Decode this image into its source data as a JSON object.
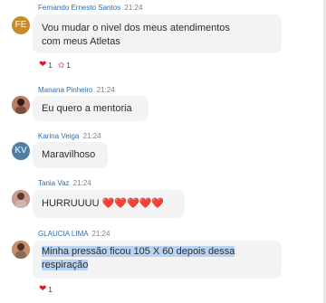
{
  "messages": [
    {
      "sender": "Fernando Ernesto Santos",
      "time": "21:24",
      "avatar_initials": "FE",
      "text": "Vou mudar o nivel dos meus atendimentos\ncom meus Atletas",
      "reactions": [
        {
          "icon": "heart-icon",
          "count": "1"
        },
        {
          "icon": "lungs-icon",
          "count": "1"
        }
      ]
    },
    {
      "sender": "Manana Pinheiro",
      "time": "21:24",
      "text": "Eu quero a mentoria"
    },
    {
      "sender": "Karina Veiga",
      "time": "21:24",
      "avatar_initials": "KV",
      "text": "Maravilhoso"
    },
    {
      "sender": "Tania Vaz",
      "time": "21:24",
      "text": "HURRUUUU ❤️❤️❤️❤️❤️"
    },
    {
      "sender": "GLAUCIA LIMA",
      "time": "21:24",
      "text_line1": "Minha pressão ficou 105 X 60 depois dessa",
      "text_line2": "respiração",
      "reactions": [
        {
          "icon": "heart-icon",
          "count": "1"
        }
      ]
    }
  ]
}
